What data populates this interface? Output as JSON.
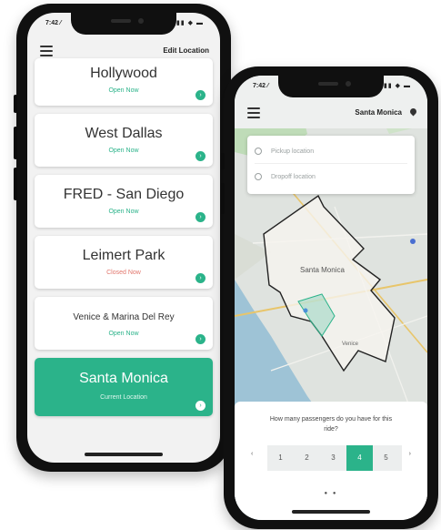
{
  "left_phone": {
    "status": {
      "time": "7:42 ⁄",
      "icons": "▮▮ ◆ ▬"
    },
    "header": {
      "edit_label": "Edit Location"
    },
    "locations": [
      {
        "name": "Hollywood",
        "status": "Open Now",
        "status_color": "#2bb38a"
      },
      {
        "name": "West Dallas",
        "status": "Open Now",
        "status_color": "#2bb38a"
      },
      {
        "name": "FRED - San Diego",
        "status": "Open Now",
        "status_color": "#2bb38a"
      },
      {
        "name": "Leimert Park",
        "status": "Closed Now",
        "status_color": "#e2776d"
      },
      {
        "name": "Venice & Marina Del Rey",
        "status": "Open Now",
        "status_color": "#2bb38a"
      },
      {
        "name": "Santa Monica",
        "status": "Current Location",
        "active": true
      }
    ],
    "badge_glyph": "›"
  },
  "right_phone": {
    "status": {
      "time": "7:42 ⁄",
      "icons": "▮▮ ◆ ▬"
    },
    "header": {
      "title": "Santa Monica"
    },
    "search": {
      "pickup_placeholder": "Pickup location",
      "dropoff_placeholder": "Dropoff location"
    },
    "map": {
      "city_label": "Santa Monica",
      "venice_label": "Venice"
    },
    "passengers": {
      "question": "How many passengers do you have for this ride?",
      "options": [
        "1",
        "2",
        "3",
        "4",
        "5"
      ],
      "selected": "4",
      "prev_arrow": "‹",
      "next_arrow": "›"
    },
    "pager_dots": "● ●"
  },
  "colors": {
    "accent": "#2bb38a",
    "closed": "#e2776d",
    "frame": "#101010"
  }
}
